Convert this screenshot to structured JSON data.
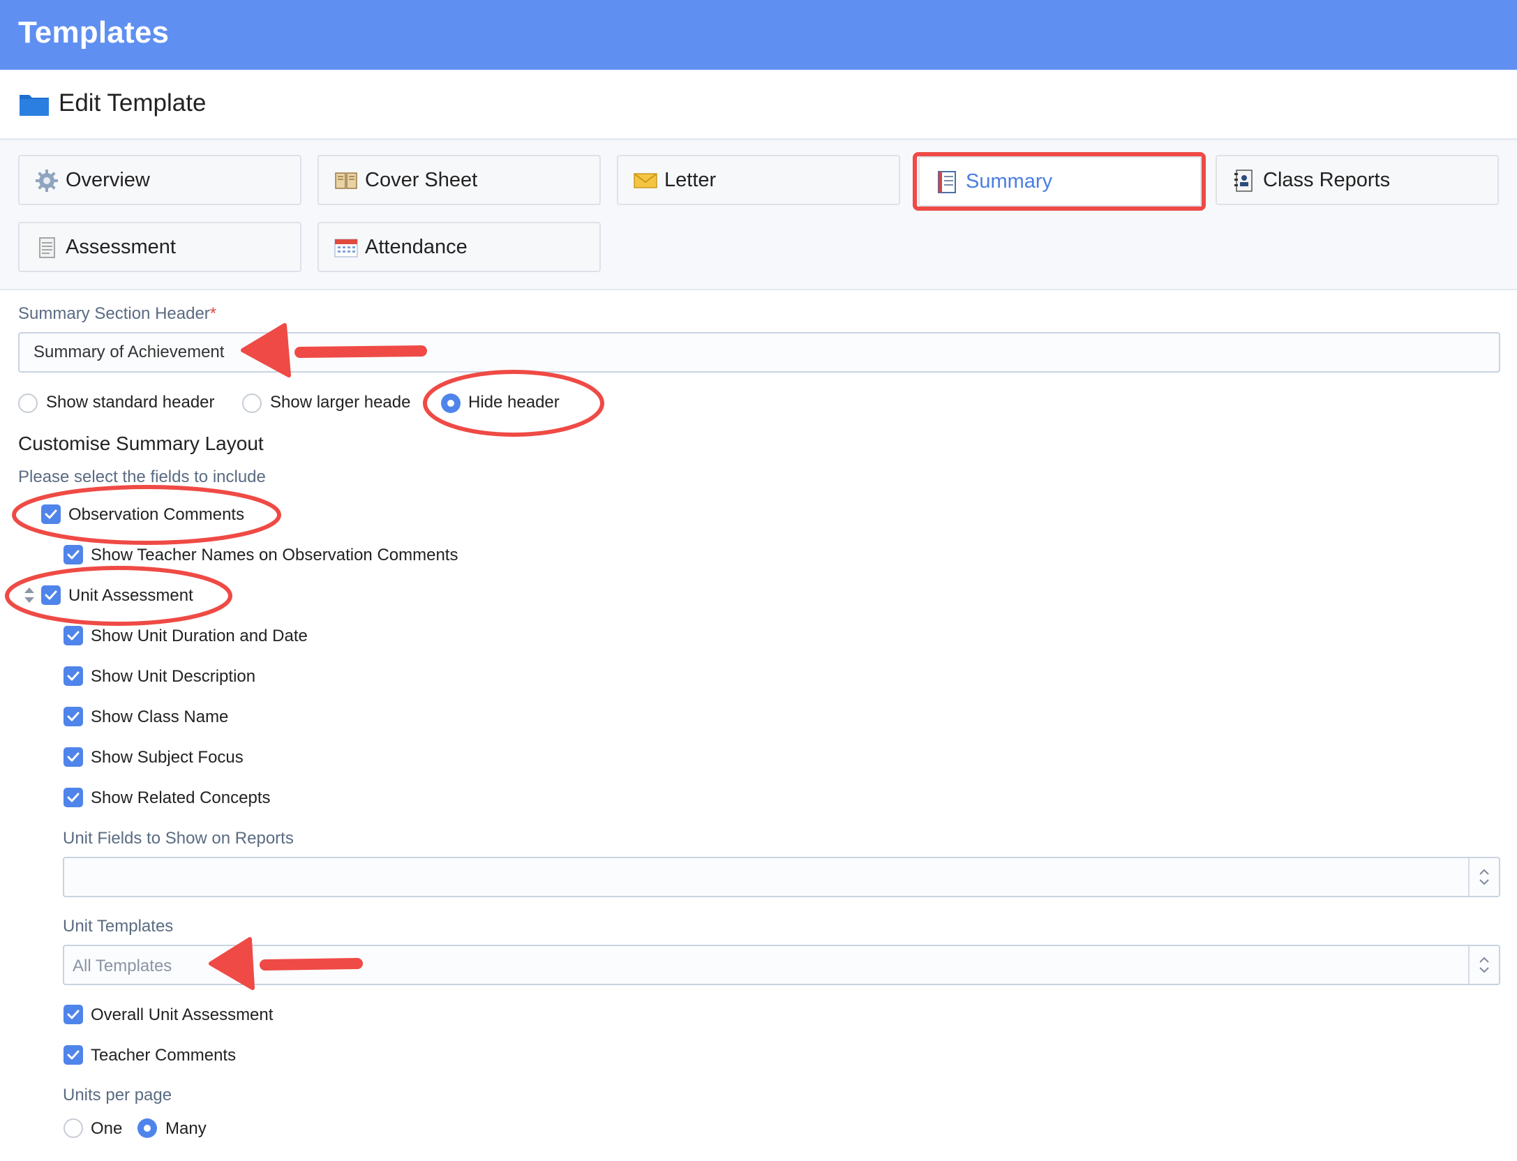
{
  "app": {
    "title": "Templates"
  },
  "page": {
    "title": "Edit Template"
  },
  "tabs": [
    {
      "label": "Overview",
      "icon": "gear-icon"
    },
    {
      "label": "Cover Sheet",
      "icon": "book-icon"
    },
    {
      "label": "Letter",
      "icon": "envelope-icon"
    },
    {
      "label": "Summary",
      "icon": "document-icon",
      "active": true
    },
    {
      "label": "Class Reports",
      "icon": "notebook-icon"
    },
    {
      "label": "Assessment",
      "icon": "notes-icon"
    },
    {
      "label": "Attendance",
      "icon": "calendar-icon"
    }
  ],
  "summary_header": {
    "label": "Summary Section Header",
    "required_mark": "*",
    "value": "Summary of Achievement",
    "options": [
      {
        "label": "Show standard header",
        "checked": false
      },
      {
        "label": "Show larger heade",
        "checked": false
      },
      {
        "label": "Hide header",
        "checked": true
      }
    ]
  },
  "layout": {
    "title": "Customise Summary Layout",
    "hint": "Please select the fields to include",
    "observation_comments": "Observation Comments",
    "show_teacher_names": "Show Teacher Names on Observation Comments",
    "unit_assessment": "Unit Assessment",
    "unit_options": [
      "Show Unit Duration and Date",
      "Show Unit Description",
      "Show Class Name",
      "Show Subject Focus",
      "Show Related Concepts"
    ],
    "unit_fields_label": "Unit Fields to Show on Reports",
    "unit_fields_value": "",
    "unit_templates_label": "Unit Templates",
    "unit_templates_value": "All Templates",
    "overall_unit_assessment": "Overall Unit Assessment",
    "teacher_comments": "Teacher Comments",
    "units_per_page": {
      "label": "Units per page",
      "options": [
        {
          "label": "One",
          "checked": false
        },
        {
          "label": "Many",
          "checked": true
        }
      ]
    }
  },
  "colors": {
    "accent": "#5f8ff1",
    "checkbox": "#4f84ea",
    "annotation": "#ef4a45"
  }
}
